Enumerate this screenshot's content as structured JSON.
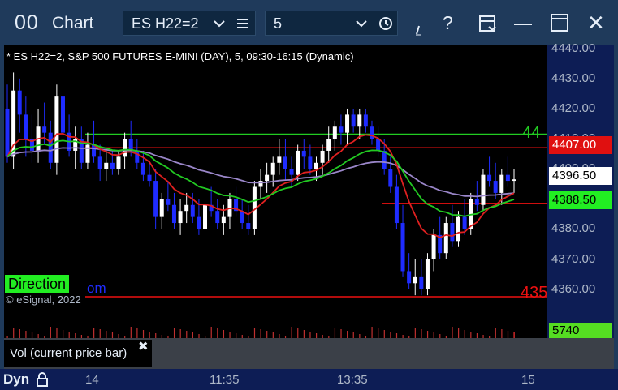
{
  "window": {
    "logo_text": "00",
    "title": "Chart",
    "symbol_value": "ES H22=2",
    "interval_value": "5",
    "icons": [
      "list-icon",
      "clock-icon",
      "draw-icon",
      "help-icon",
      "layout-icon",
      "minimize-icon",
      "maximize-icon",
      "close-icon"
    ],
    "help_glyph": "?",
    "close_glyph": "✕"
  },
  "chart": {
    "header": "* ES H22=2, S&P 500 FUTURES E-MINI (DAY), 5, 09:30-16:15 (Dynamic)",
    "copyright": "© eSignal, 2022",
    "direction_label": "Direction",
    "direction_suffix": "om",
    "level_label_green": "44",
    "level_label_red": "435",
    "colors": {
      "up": "#ffffff",
      "down": "#1f2cff",
      "ema_red": "#e02020",
      "ema_green": "#22c922",
      "avg_purple": "#9a86c9",
      "level_green": "#22cc22",
      "level_red": "#ee1111"
    }
  },
  "chart_data": {
    "type": "candlestick",
    "ylim": [
      4354,
      4441
    ],
    "price_ticks": [
      "4440.00",
      "4430.00",
      "4420.00",
      "4410.00",
      "4400.00",
      "4380.00",
      "4370.00",
      "4360.00"
    ],
    "time_ticks": [
      "14",
      "11:35",
      "13:35",
      "15"
    ],
    "last_price": "4396.50",
    "level_labels": [
      {
        "label": "4407.00",
        "color": "#ee1111"
      },
      {
        "label": "4388.50",
        "color": "#22cc22"
      }
    ],
    "horizontal_levels": [
      {
        "value": 4411.5,
        "color": "#22cc22"
      },
      {
        "value": 4407.0,
        "color": "#ee1111"
      },
      {
        "value": 4388.5,
        "color": "#ee1111"
      },
      {
        "value": 4357.5,
        "color": "#ee1111"
      }
    ],
    "candles": [
      [
        4420,
        4428,
        4402,
        4404
      ],
      [
        4404,
        4432,
        4400,
        4426
      ],
      [
        4426,
        4430,
        4412,
        4418
      ],
      [
        4418,
        4424,
        4404,
        4410
      ],
      [
        4410,
        4418,
        4402,
        4406
      ],
      [
        4406,
        4420,
        4402,
        4414
      ],
      [
        4414,
        4422,
        4408,
        4412
      ],
      [
        4412,
        4416,
        4400,
        4402
      ],
      [
        4402,
        4428,
        4398,
        4424
      ],
      [
        4424,
        4428,
        4410,
        4412
      ],
      [
        4412,
        4418,
        4404,
        4406
      ],
      [
        4406,
        4414,
        4400,
        4410
      ],
      [
        4410,
        4414,
        4400,
        4402
      ],
      [
        4402,
        4412,
        4400,
        4408
      ],
      [
        4408,
        4416,
        4402,
        4404
      ],
      [
        4404,
        4408,
        4396,
        4400
      ],
      [
        4400,
        4406,
        4396,
        4402
      ],
      [
        4402,
        4406,
        4398,
        4400
      ],
      [
        4400,
        4406,
        4398,
        4404
      ],
      [
        4404,
        4412,
        4400,
        4410
      ],
      [
        4410,
        4416,
        4404,
        4406
      ],
      [
        4406,
        4410,
        4400,
        4402
      ],
      [
        4402,
        4406,
        4396,
        4398
      ],
      [
        4398,
        4402,
        4394,
        4396
      ],
      [
        4396,
        4400,
        4380,
        4384
      ],
      [
        4384,
        4392,
        4380,
        4390
      ],
      [
        4390,
        4396,
        4386,
        4388
      ],
      [
        4388,
        4392,
        4380,
        4382
      ],
      [
        4382,
        4390,
        4378,
        4386
      ],
      [
        4386,
        4392,
        4382,
        4388
      ],
      [
        4388,
        4392,
        4382,
        4384
      ],
      [
        4384,
        4390,
        4378,
        4380
      ],
      [
        4380,
        4390,
        4376,
        4388
      ],
      [
        4388,
        4394,
        4384,
        4386
      ],
      [
        4386,
        4390,
        4380,
        4382
      ],
      [
        4382,
        4388,
        4378,
        4384
      ],
      [
        4384,
        4392,
        4380,
        4390
      ],
      [
        4390,
        4394,
        4384,
        4386
      ],
      [
        4386,
        4390,
        4380,
        4382
      ],
      [
        4382,
        4388,
        4378,
        4380
      ],
      [
        4380,
        4396,
        4378,
        4394
      ],
      [
        4394,
        4400,
        4390,
        4396
      ],
      [
        4396,
        4402,
        4392,
        4398
      ],
      [
        4398,
        4404,
        4394,
        4402
      ],
      [
        4402,
        4410,
        4398,
        4404
      ],
      [
        4404,
        4410,
        4396,
        4400
      ],
      [
        4400,
        4404,
        4394,
        4398
      ],
      [
        4398,
        4408,
        4396,
        4406
      ],
      [
        4406,
        4410,
        4400,
        4404
      ],
      [
        4404,
        4408,
        4398,
        4400
      ],
      [
        4400,
        4404,
        4396,
        4402
      ],
      [
        4402,
        4408,
        4398,
        4406
      ],
      [
        4406,
        4414,
        4402,
        4410
      ],
      [
        4410,
        4416,
        4406,
        4414
      ],
      [
        4414,
        4418,
        4408,
        4412
      ],
      [
        4412,
        4420,
        4408,
        4418
      ],
      [
        4418,
        4420,
        4412,
        4414
      ],
      [
        4414,
        4420,
        4410,
        4418
      ],
      [
        4418,
        4420,
        4412,
        4414
      ],
      [
        4414,
        4416,
        4408,
        4410
      ],
      [
        4410,
        4414,
        4404,
        4406
      ],
      [
        4406,
        4410,
        4398,
        4400
      ],
      [
        4400,
        4404,
        4392,
        4394
      ],
      [
        4394,
        4398,
        4380,
        4382
      ],
      [
        4382,
        4388,
        4364,
        4366
      ],
      [
        4366,
        4372,
        4360,
        4362
      ],
      [
        4362,
        4370,
        4358,
        4364
      ],
      [
        4364,
        4370,
        4358,
        4360
      ],
      [
        4360,
        4372,
        4358,
        4370
      ],
      [
        4370,
        4380,
        4366,
        4378
      ],
      [
        4378,
        4384,
        4370,
        4372
      ],
      [
        4372,
        4384,
        4370,
        4382
      ],
      [
        4382,
        4388,
        4374,
        4376
      ],
      [
        4376,
        4386,
        4374,
        4384
      ],
      [
        4384,
        4390,
        4378,
        4380
      ],
      [
        4380,
        4392,
        4378,
        4390
      ],
      [
        4390,
        4396,
        4386,
        4388
      ],
      [
        4388,
        4400,
        4386,
        4398
      ],
      [
        4398,
        4404,
        4394,
        4396
      ],
      [
        4396,
        4402,
        4390,
        4392
      ],
      [
        4392,
        4400,
        4388,
        4398
      ],
      [
        4398,
        4404,
        4394,
        4396
      ],
      [
        4396,
        4400,
        4392,
        4396.5
      ]
    ],
    "volume_label": "5740",
    "volume_tip": "Vol (current price bar)"
  },
  "bottom": {
    "dyn_label": "Dyn",
    "lock_icon": "lock-icon",
    "close_tip": "✖"
  }
}
